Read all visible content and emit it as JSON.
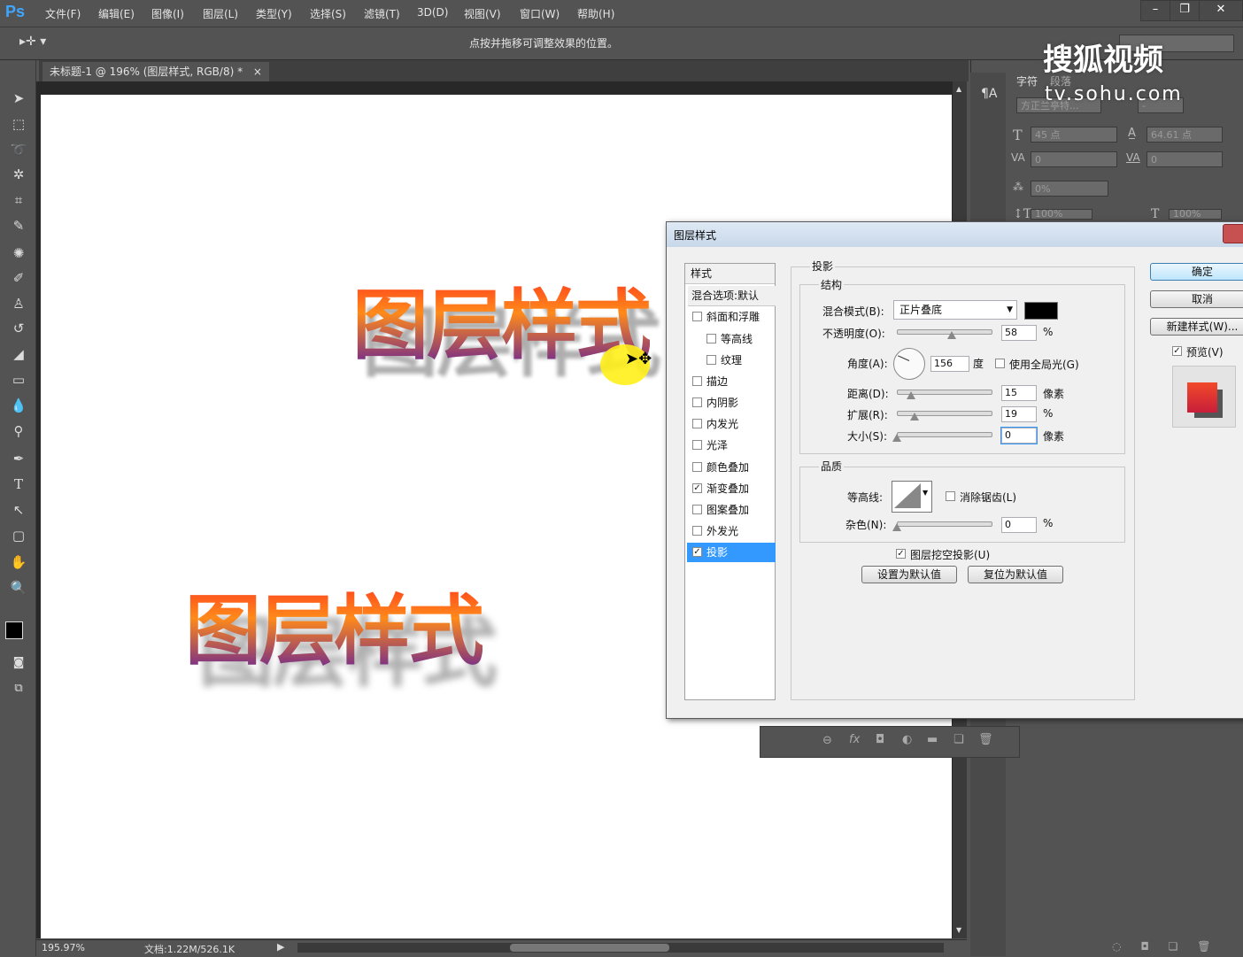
{
  "app": {
    "logo": "Ps",
    "menu": [
      "文件(F)",
      "编辑(E)",
      "图像(I)",
      "图层(L)",
      "类型(Y)",
      "选择(S)",
      "滤镜(T)",
      "3D(D)",
      "视图(V)",
      "窗口(W)",
      "帮助(H)"
    ],
    "window_buttons": [
      "–",
      "❐",
      "✕"
    ]
  },
  "options_bar": {
    "hint": "点按并拖移可调整效果的位置。"
  },
  "document": {
    "tab_title": "未标题-1 @ 196% (图层样式, RGB/8) *",
    "tab_close": "×",
    "canvas_text_top": "图层样式",
    "canvas_text_bottom": "图层样式"
  },
  "status_bar": {
    "zoom": "195.97%",
    "doc_info": "文档:1.22M/526.1K"
  },
  "right_panel": {
    "tabs": [
      "字符",
      "段落"
    ],
    "font_family": "方正兰亭特...",
    "font_style": "-",
    "font_size": "45 点",
    "leading": "64.61 点",
    "kerning": "0",
    "tracking": "0",
    "scale": "0%",
    "vscale": "100%",
    "hscale": "100%"
  },
  "watermark": {
    "brand": "搜狐视频",
    "url": "tv.sohu.com"
  },
  "dialog": {
    "title": "图层样式",
    "style_list": {
      "header": "样式",
      "items": [
        {
          "label": "混合选项:默认",
          "checkbox": false,
          "checked": false,
          "selected": false
        },
        {
          "label": "斜面和浮雕",
          "checkbox": true,
          "checked": false,
          "selected": false
        },
        {
          "label": "等高线",
          "checkbox": true,
          "checked": false,
          "selected": false
        },
        {
          "label": "纹理",
          "checkbox": true,
          "checked": false,
          "selected": false
        },
        {
          "label": "描边",
          "checkbox": true,
          "checked": false,
          "selected": false
        },
        {
          "label": "内阴影",
          "checkbox": true,
          "checked": false,
          "selected": false
        },
        {
          "label": "内发光",
          "checkbox": true,
          "checked": false,
          "selected": false
        },
        {
          "label": "光泽",
          "checkbox": true,
          "checked": false,
          "selected": false
        },
        {
          "label": "颜色叠加",
          "checkbox": true,
          "checked": false,
          "selected": false
        },
        {
          "label": "渐变叠加",
          "checkbox": true,
          "checked": true,
          "selected": false
        },
        {
          "label": "图案叠加",
          "checkbox": true,
          "checked": false,
          "selected": false
        },
        {
          "label": "外发光",
          "checkbox": true,
          "checked": false,
          "selected": false
        },
        {
          "label": "投影",
          "checkbox": true,
          "checked": true,
          "selected": true
        }
      ]
    },
    "section_title": "投影",
    "structure": {
      "title": "结构",
      "blend_mode_label": "混合模式(B):",
      "blend_mode_value": "正片叠底",
      "shadow_color": "#000000",
      "opacity_label": "不透明度(O):",
      "opacity_value": "58",
      "opacity_unit": "%",
      "angle_label": "角度(A):",
      "angle_value": "156",
      "angle_unit": "度",
      "global_light_label": "使用全局光(G)",
      "distance_label": "距离(D):",
      "distance_value": "15",
      "distance_unit": "像素",
      "spread_label": "扩展(R):",
      "spread_value": "19",
      "spread_unit": "%",
      "size_label": "大小(S):",
      "size_value": "0",
      "size_unit": "像素"
    },
    "quality": {
      "title": "品质",
      "contour_label": "等高线:",
      "anti_alias_label": "消除锯齿(L)",
      "noise_label": "杂色(N):",
      "noise_value": "0",
      "noise_unit": "%"
    },
    "knockout_label": "图层挖空投影(U)",
    "set_default": "设置为默认值",
    "reset_default": "复位为默认值",
    "ok": "确定",
    "cancel": "取消",
    "new_style": "新建样式(W)...",
    "preview_label": "预览(V)"
  }
}
